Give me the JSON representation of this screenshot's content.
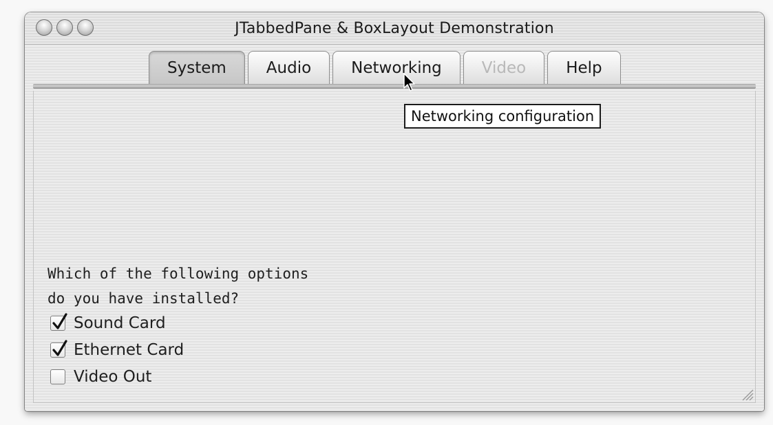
{
  "window": {
    "title": "JTabbedPane & BoxLayout Demonstration"
  },
  "tabs": [
    {
      "label": "System",
      "state": "selected"
    },
    {
      "label": "Audio",
      "state": "normal"
    },
    {
      "label": "Networking",
      "state": "hover"
    },
    {
      "label": "Video",
      "state": "disabled"
    },
    {
      "label": "Help",
      "state": "normal"
    }
  ],
  "tooltip": {
    "text": "Networking configuration"
  },
  "panel": {
    "question_line1": "Which of the following options",
    "question_line2": "do you have installed?",
    "options": [
      {
        "label": "Sound Card",
        "checked": true
      },
      {
        "label": "Ethernet Card",
        "checked": true
      },
      {
        "label": "Video Out",
        "checked": false
      }
    ]
  },
  "icons": {
    "window_controls": [
      "close-button-icon",
      "minimize-button-icon",
      "zoom-button-icon"
    ],
    "cursor": "arrow-pointer-icon",
    "checkmark": "checkmark-icon",
    "resize": "resize-grip-icon"
  }
}
